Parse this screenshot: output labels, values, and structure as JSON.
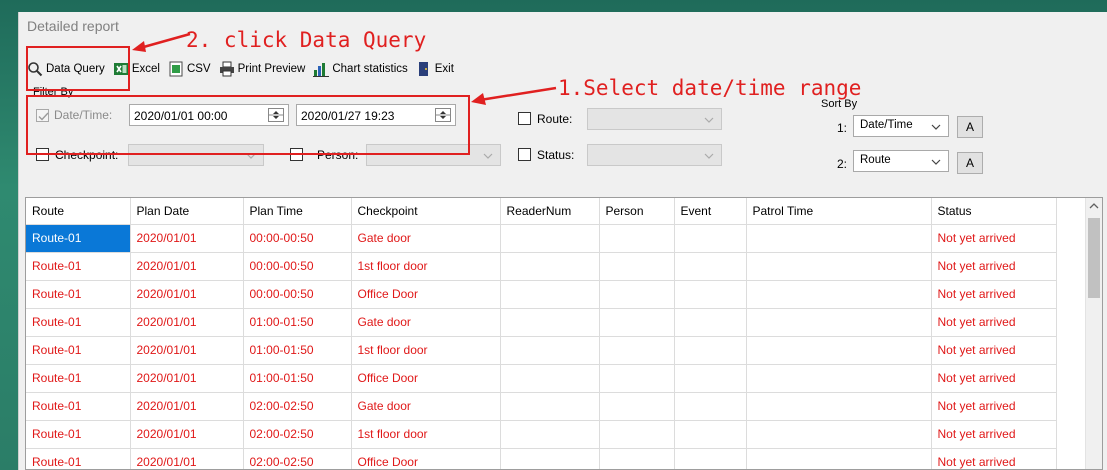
{
  "window": {
    "title": "Detailed report"
  },
  "toolbar": {
    "items": [
      {
        "label": "Data Query",
        "icon": "magnifier-icon"
      },
      {
        "label": "Excel",
        "icon": "excel-icon"
      },
      {
        "label": "CSV",
        "icon": "csv-icon"
      },
      {
        "label": "Print Preview",
        "icon": "printer-icon"
      },
      {
        "label": "Chart statistics",
        "icon": "chart-icon"
      },
      {
        "label": "Exit",
        "icon": "exit-icon"
      }
    ]
  },
  "filter": {
    "group_label": "Filter By",
    "datetime_label": "Date/Time:",
    "datetime_checked": true,
    "start": "2020/01/01 00:00",
    "end": "2020/01/27 19:23",
    "route_label": "Route:",
    "checkpoint_label": "Checkpoint:",
    "person_label": "Person:",
    "status_label": "Status:"
  },
  "sort": {
    "group_label": "Sort By",
    "row1_index": "1:",
    "row1_value": "Date/Time",
    "row2_index": "2:",
    "row2_value": "Route",
    "order_label": "A"
  },
  "annotations": {
    "step2": "2. click Data Query",
    "step1": "1.Select date/time range"
  },
  "table": {
    "columns": [
      "Route",
      "Plan Date",
      "Plan Time",
      "Checkpoint",
      "ReaderNum",
      "Person",
      "Event",
      "Patrol Time",
      "Status"
    ],
    "rows": [
      [
        "Route-01",
        "2020/01/01",
        "00:00-00:50",
        "Gate door",
        "",
        "",
        "",
        "",
        "Not yet arrived"
      ],
      [
        "Route-01",
        "2020/01/01",
        "00:00-00:50",
        "1st floor door",
        "",
        "",
        "",
        "",
        "Not yet arrived"
      ],
      [
        "Route-01",
        "2020/01/01",
        "00:00-00:50",
        "Office Door",
        "",
        "",
        "",
        "",
        "Not yet arrived"
      ],
      [
        "Route-01",
        "2020/01/01",
        "01:00-01:50",
        "Gate door",
        "",
        "",
        "",
        "",
        "Not yet arrived"
      ],
      [
        "Route-01",
        "2020/01/01",
        "01:00-01:50",
        "1st floor door",
        "",
        "",
        "",
        "",
        "Not yet arrived"
      ],
      [
        "Route-01",
        "2020/01/01",
        "01:00-01:50",
        "Office Door",
        "",
        "",
        "",
        "",
        "Not yet arrived"
      ],
      [
        "Route-01",
        "2020/01/01",
        "02:00-02:50",
        "Gate door",
        "",
        "",
        "",
        "",
        "Not yet arrived"
      ],
      [
        "Route-01",
        "2020/01/01",
        "02:00-02:50",
        "1st floor door",
        "",
        "",
        "",
        "",
        "Not yet arrived"
      ],
      [
        "Route-01",
        "2020/01/01",
        "02:00-02:50",
        "Office Door",
        "",
        "",
        "",
        "",
        "Not yet arrived"
      ]
    ]
  },
  "colors": {
    "annotation": "#e02020",
    "row_text": "#e01818",
    "selection": "#0a78d7"
  }
}
